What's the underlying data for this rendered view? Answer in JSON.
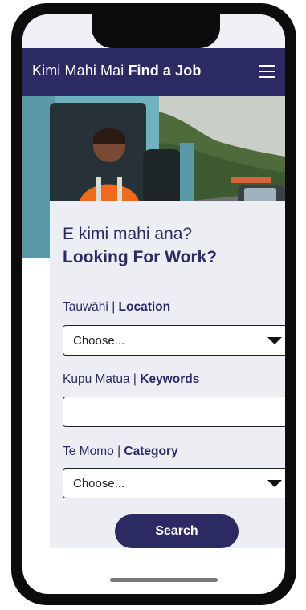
{
  "header": {
    "brand_maori": "Kimi Mahi Mai",
    "brand_english": "Find a Job",
    "menu_icon": "hamburger-menu-icon"
  },
  "form": {
    "heading_maori": "E kimi mahi ana?",
    "heading_english": "Looking For Work?",
    "location": {
      "label_maori": "Tauwāhi",
      "separator": "|",
      "label_english": "Location",
      "selected": "Choose..."
    },
    "keywords": {
      "label_maori": "Kupu Matua",
      "separator": "|",
      "label_english": "Keywords",
      "value": ""
    },
    "category": {
      "label_maori": "Te Momo",
      "separator": "|",
      "label_english": "Category",
      "selected": "Choose..."
    },
    "search_label": "Search"
  },
  "colors": {
    "brand_navy": "#2b2a63",
    "panel_bg": "#eceef3"
  }
}
